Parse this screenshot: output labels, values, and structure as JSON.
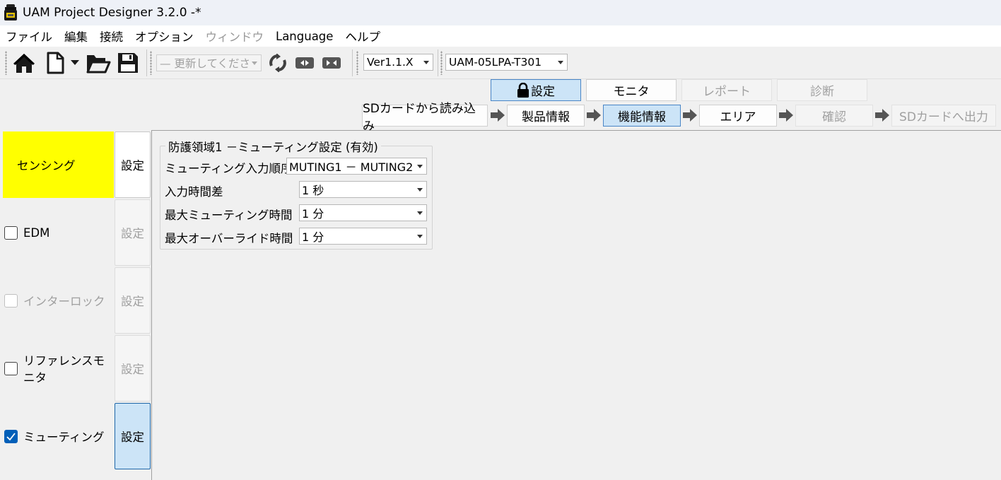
{
  "window": {
    "title": "UAM Project Designer 3.2.0 -*"
  },
  "menu": {
    "items": [
      {
        "label": "ファイル",
        "disabled": false
      },
      {
        "label": "編集",
        "disabled": false
      },
      {
        "label": "接続",
        "disabled": false
      },
      {
        "label": "オプション",
        "disabled": false
      },
      {
        "label": "ウィンドウ",
        "disabled": true
      },
      {
        "label": "Language",
        "disabled": false
      },
      {
        "label": "ヘルプ",
        "disabled": false
      }
    ]
  },
  "toolbar": {
    "update_combo": "— 更新してくださ",
    "version_combo": "Ver1.1.X",
    "model_combo": "UAM-05LPA-T301"
  },
  "mode_tabs": {
    "settings": "設定",
    "monitor": "モニタ",
    "report": "レポート",
    "diagnosis": "診断"
  },
  "workflow": {
    "sd_read": "SDカードから読み込み",
    "product_info": "製品情報",
    "function_info": "機能情報",
    "area": "エリア",
    "confirm": "確認",
    "sd_write": "SDカードへ出力"
  },
  "functions": {
    "sensing": {
      "label": "センシング",
      "button": "設定"
    },
    "edm": {
      "label": "EDM",
      "button": "設定",
      "checked": false
    },
    "interlock": {
      "label": "インターロック",
      "button": "設定",
      "checked": false
    },
    "reference_monitor": {
      "label": "リファレンスモニタ",
      "button": "設定",
      "checked": false
    },
    "muting": {
      "label": "ミューティング",
      "button": "設定",
      "checked": true
    }
  },
  "muting_settings": {
    "group_title": "防護領域1 －ミューティング設定 (有効)",
    "rows": [
      {
        "label": "ミューティング入力順序",
        "value": "MUTING1 － MUTING2"
      },
      {
        "label": "入力時間差",
        "value": "1 秒"
      },
      {
        "label": "最大ミューティング時間",
        "value": "1 分"
      },
      {
        "label": "最大オーバーライド時間",
        "value": "1 分"
      }
    ]
  },
  "colors": {
    "highlight": "#ffff00",
    "accent": "#cce4f7",
    "accent_border": "#4a86c6",
    "checkbox_checked": "#005fb8"
  }
}
